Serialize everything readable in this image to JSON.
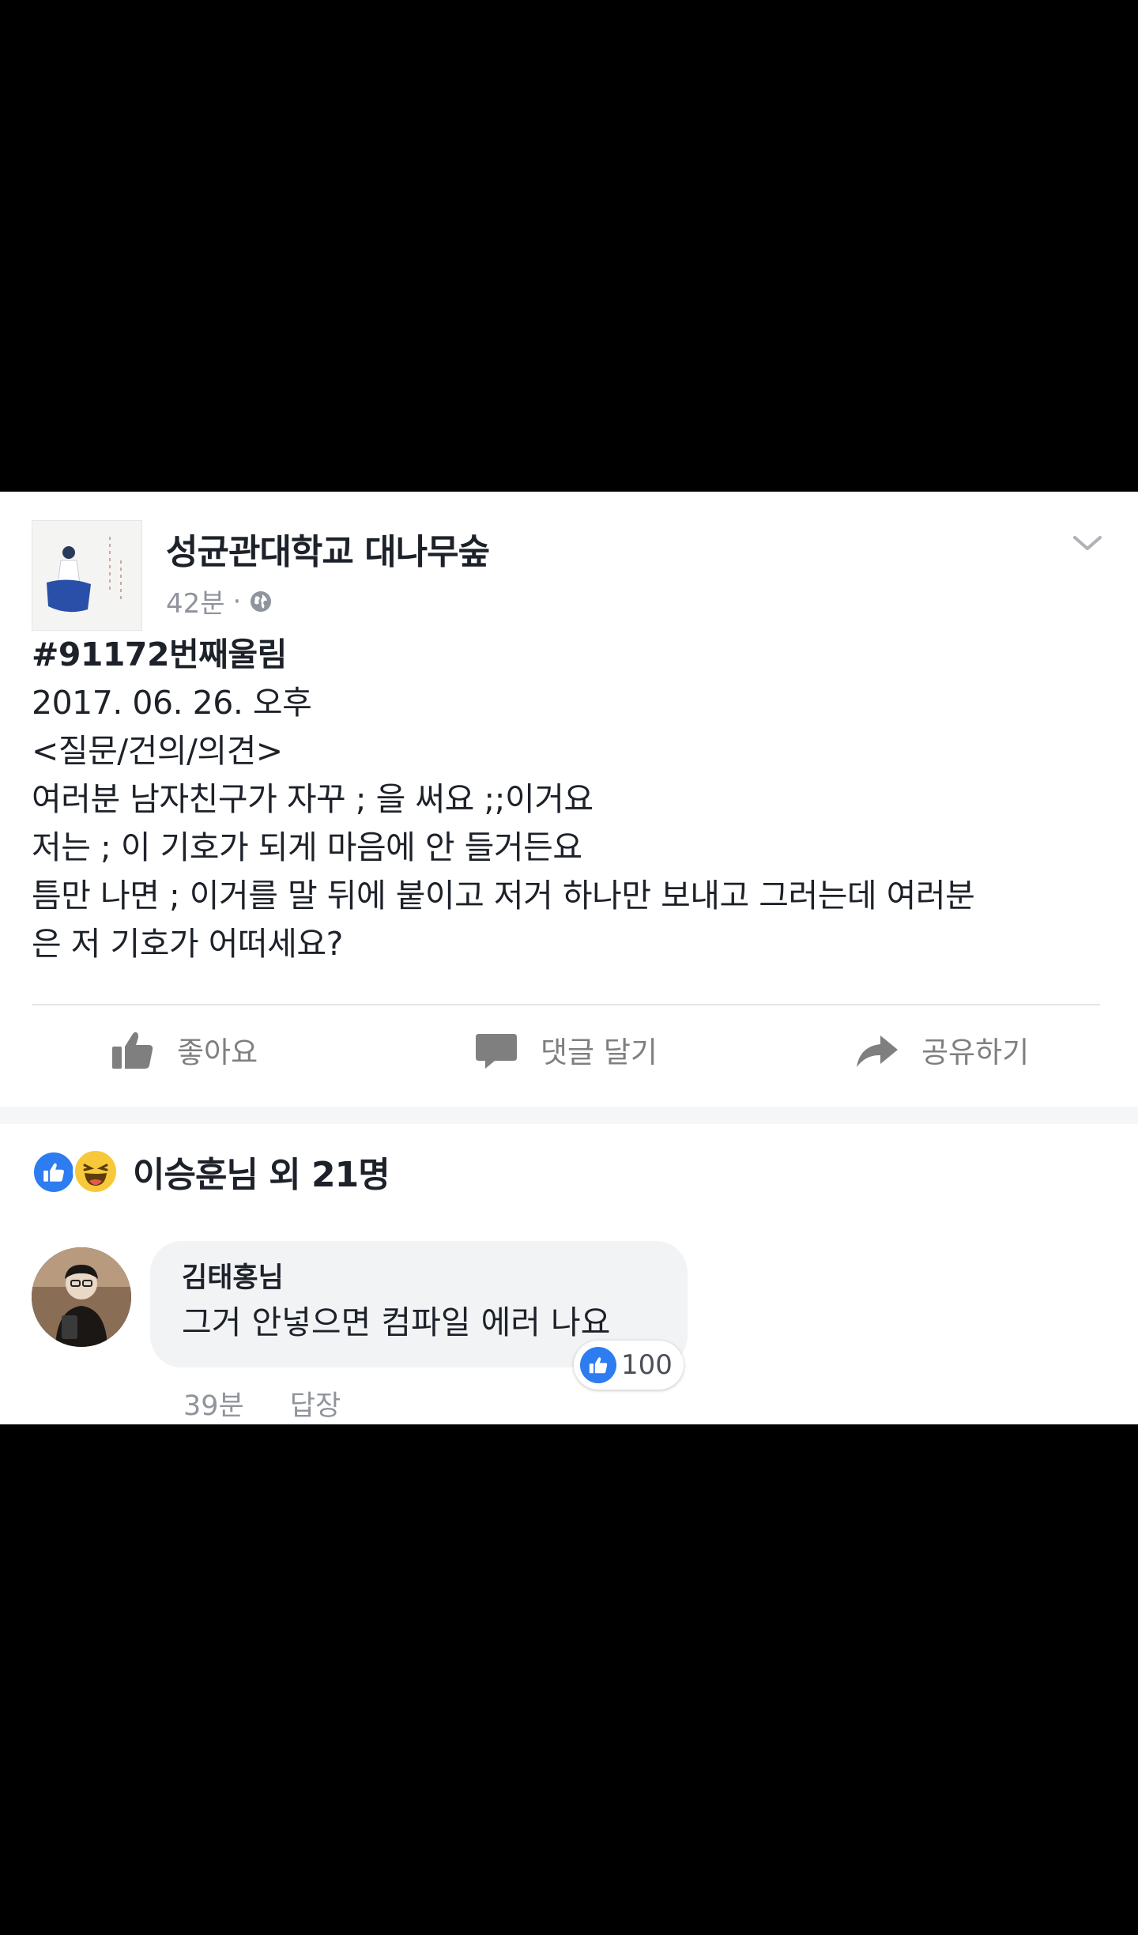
{
  "post": {
    "page_name": "성균관대학교 대나무숲",
    "time": "42분",
    "dot": "·",
    "body": {
      "tag": "#91172번째울림",
      "lines": [
        "2017. 06. 26. 오후",
        "<질문/건의/의견>",
        "여러분 남자친구가 자꾸 ; 을 써요 ;;이거요",
        "저는 ; 이 기호가 되게 마음에 안 들거든요",
        "틈만 나면 ; 이거를 말 뒤에 붙이고 저거 하나만 보내고 그러는데 여러분",
        "은 저 기호가 어떠세요?"
      ]
    },
    "actions": {
      "like": "좋아요",
      "comment": "댓글 달기",
      "share": "공유하기"
    }
  },
  "reactions": {
    "summary": "이승훈님 외 21명",
    "types": [
      "like",
      "haha"
    ]
  },
  "comment": {
    "author": "김태홍님",
    "text": "그거 안넣으면 컴파일 에러 나요",
    "like_count": "100",
    "time": "39분",
    "reply_label": "답장"
  },
  "colors": {
    "background": "#000000",
    "card": "#ffffff",
    "like_blue": "#2d7cf0",
    "muted_text": "#90949c",
    "bubble": "#f2f3f5"
  }
}
